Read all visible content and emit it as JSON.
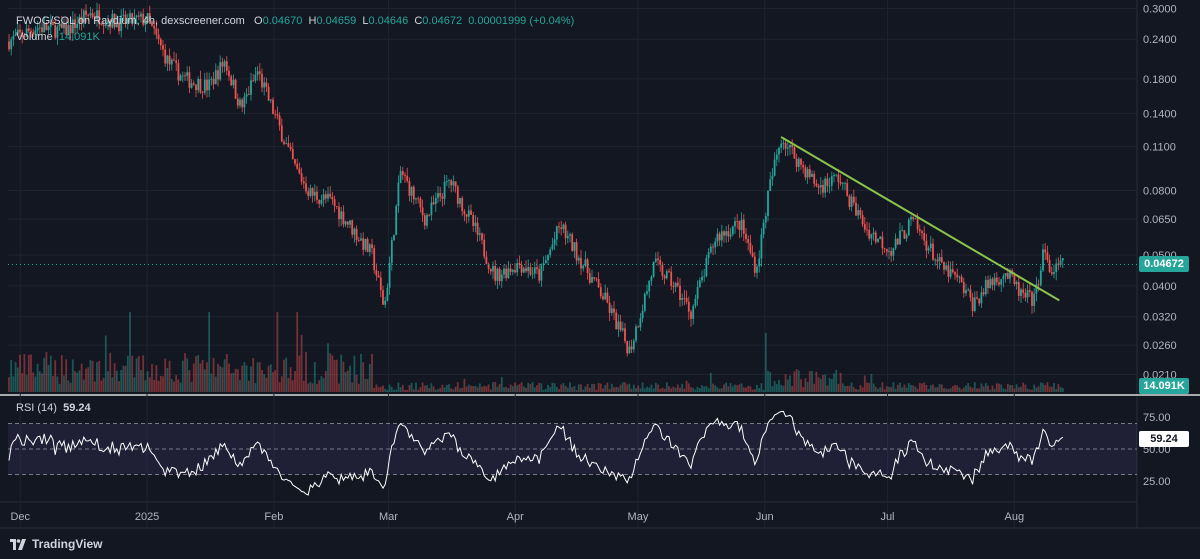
{
  "header": {
    "symbol_line": "FWOG/SOL on Raydium, 4h, dexscreener.com",
    "ohlc": [
      {
        "label": "O",
        "value": "0.04670"
      },
      {
        "label": "H",
        "value": "0.04659"
      },
      {
        "label": "L",
        "value": "0.04646"
      },
      {
        "label": "C",
        "value": "0.04672"
      }
    ],
    "change": "0.00001999 (+0.04%)",
    "volume_label": "Volume",
    "volume_value": "14.091K"
  },
  "price_tag": "0.04672",
  "volume_tag": "14.091K",
  "rsi": {
    "label": "RSI (14)",
    "value": "59.24",
    "tag": "59.24",
    "levels": [
      "75.00",
      "50.00",
      "25.00"
    ]
  },
  "brand": "TradingView",
  "colors": {
    "bg": "#131722",
    "up": "#26a69a",
    "down": "#ef5350",
    "trendline": "#8bc34a",
    "rsi_line": "#ffffff",
    "rsi_band": "#7e57c2"
  },
  "chart_data": {
    "type": "candlestick",
    "price_axis_labels": [
      "0.3000",
      "0.2400",
      "0.1800",
      "0.1400",
      "0.1100",
      "0.0800",
      "0.0650",
      "0.0500",
      "0.0400",
      "0.0320",
      "0.0260",
      "0.0210"
    ],
    "time_axis_labels": [
      "Dec",
      "2025",
      "Feb",
      "Mar",
      "Apr",
      "May",
      "Jun",
      "Jul",
      "Aug"
    ],
    "price_scale": "log",
    "price_range": [
      0.0185,
      0.31
    ],
    "time_range": [
      "2024-11-28",
      "2025-08-31"
    ],
    "close_path": [
      [
        "2024-11-28",
        0.236
      ],
      [
        "2024-12-05",
        0.262
      ],
      [
        "2024-12-12",
        0.255
      ],
      [
        "2024-12-18",
        0.29
      ],
      [
        "2024-12-25",
        0.27
      ],
      [
        "2025-01-01",
        0.278
      ],
      [
        "2025-01-06",
        0.205
      ],
      [
        "2025-01-10",
        0.18
      ],
      [
        "2025-01-16",
        0.17
      ],
      [
        "2025-01-20",
        0.205
      ],
      [
        "2025-01-24",
        0.145
      ],
      [
        "2025-01-28",
        0.19
      ],
      [
        "2025-02-02",
        0.13
      ],
      [
        "2025-02-06",
        0.095
      ],
      [
        "2025-02-10",
        0.078
      ],
      [
        "2025-02-15",
        0.074
      ],
      [
        "2025-02-20",
        0.061
      ],
      [
        "2025-02-25",
        0.05
      ],
      [
        "2025-02-28",
        0.034
      ],
      [
        "2025-03-04",
        0.092
      ],
      [
        "2025-03-10",
        0.065
      ],
      [
        "2025-03-16",
        0.086
      ],
      [
        "2025-03-22",
        0.061
      ],
      [
        "2025-03-27",
        0.043
      ],
      [
        "2025-04-02",
        0.047
      ],
      [
        "2025-04-07",
        0.043
      ],
      [
        "2025-04-12",
        0.062
      ],
      [
        "2025-04-18",
        0.046
      ],
      [
        "2025-04-23",
        0.036
      ],
      [
        "2025-04-29",
        0.025
      ],
      [
        "2025-05-05",
        0.047
      ],
      [
        "2025-05-10",
        0.04
      ],
      [
        "2025-05-14",
        0.033
      ],
      [
        "2025-05-20",
        0.057
      ],
      [
        "2025-05-26",
        0.063
      ],
      [
        "2025-05-30",
        0.045
      ],
      [
        "2025-06-02",
        0.08
      ],
      [
        "2025-06-05",
        0.118
      ],
      [
        "2025-06-08",
        0.104
      ],
      [
        "2025-06-14",
        0.082
      ],
      [
        "2025-06-19",
        0.088
      ],
      [
        "2025-06-22",
        0.074
      ],
      [
        "2025-06-26",
        0.06
      ],
      [
        "2025-07-02",
        0.052
      ],
      [
        "2025-07-07",
        0.064
      ],
      [
        "2025-07-10",
        0.056
      ],
      [
        "2025-07-14",
        0.046
      ],
      [
        "2025-07-18",
        0.042
      ],
      [
        "2025-07-22",
        0.035
      ],
      [
        "2025-07-26",
        0.041
      ],
      [
        "2025-07-30",
        0.044
      ],
      [
        "2025-08-03",
        0.037
      ],
      [
        "2025-08-06",
        0.036
      ],
      [
        "2025-08-08",
        0.051
      ],
      [
        "2025-08-10",
        0.044
      ],
      [
        "2025-08-13",
        0.0467
      ]
    ],
    "trendline": [
      [
        "2025-06-05",
        0.118
      ],
      [
        "2025-08-12",
        0.036
      ]
    ],
    "last_close": 0.04672,
    "rsi_range": [
      10,
      90
    ],
    "rsi_last": 59.24
  }
}
